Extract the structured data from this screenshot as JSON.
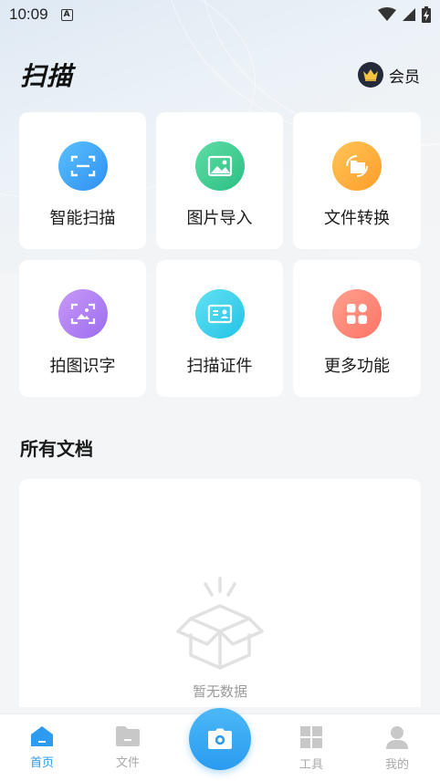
{
  "status_bar": {
    "time": "10:09",
    "notif_icon": "a-notification-icon"
  },
  "header": {
    "title": "扫描",
    "vip_label": "会员"
  },
  "features": [
    {
      "label": "智能扫描",
      "icon": "scan-frame-icon",
      "color_start": "#5ac1ff",
      "color_end": "#2f8ff0"
    },
    {
      "label": "图片导入",
      "icon": "image-icon",
      "color_start": "#5fdda5",
      "color_end": "#2bbf84"
    },
    {
      "label": "文件转换",
      "icon": "folder-convert-icon",
      "color_start": "#ffc557",
      "color_end": "#ff9d2a"
    },
    {
      "label": "拍图识字",
      "icon": "photo-text-icon",
      "color_start": "#c99af7",
      "color_end": "#9a6cf0"
    },
    {
      "label": "扫描证件",
      "icon": "id-card-icon",
      "color_start": "#63e2f2",
      "color_end": "#23c2e6"
    },
    {
      "label": "更多功能",
      "icon": "apps-icon",
      "color_start": "#ffa08e",
      "color_end": "#ff7466"
    }
  ],
  "documents": {
    "title": "所有文档",
    "empty_text": "暂无数据"
  },
  "bottom_nav": {
    "items": [
      {
        "label": "首页",
        "icon": "home-icon",
        "active": true
      },
      {
        "label": "文件",
        "icon": "folder-icon",
        "active": false
      },
      {
        "label": "工具",
        "icon": "tools-grid-icon",
        "active": false
      },
      {
        "label": "我的",
        "icon": "profile-icon",
        "active": false
      }
    ],
    "camera_icon": "camera-icon"
  },
  "colors": {
    "accent": "#2d9cf0",
    "inactive": "#a9a9a9",
    "vip_badge": "#252a3a",
    "crown": "#f5c542"
  }
}
